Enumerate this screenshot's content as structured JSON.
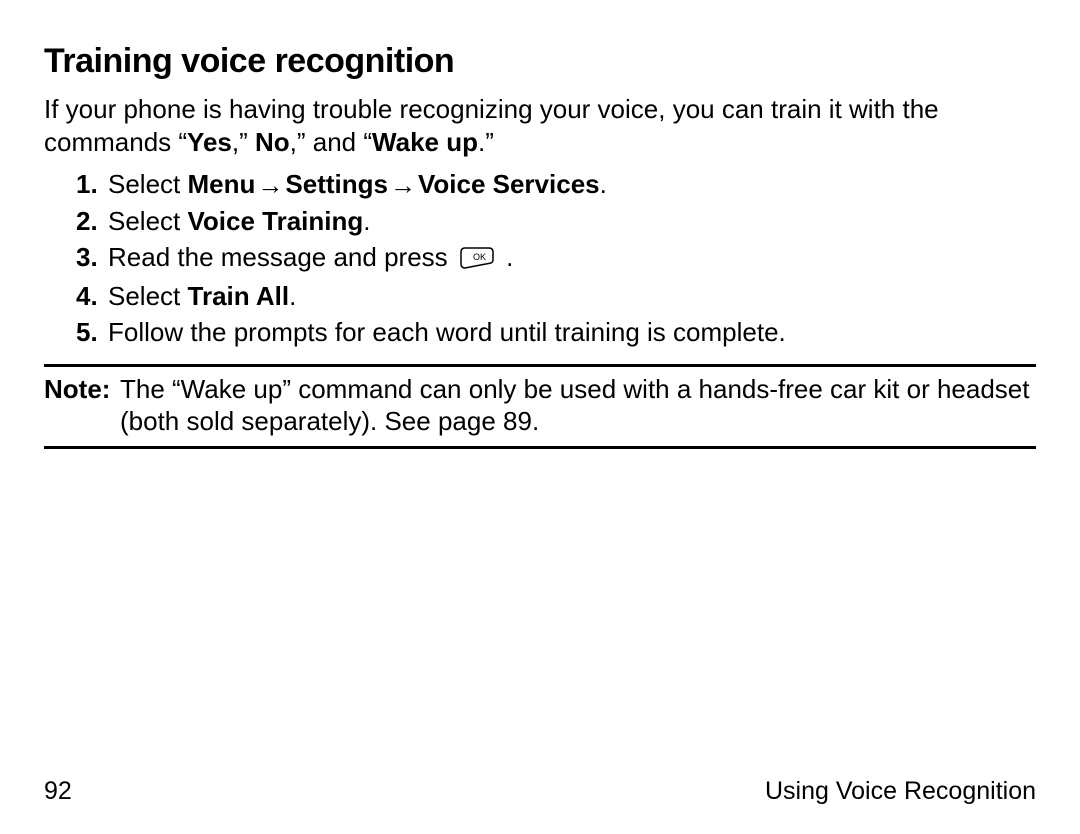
{
  "heading": "Training voice recognition",
  "intro": {
    "p1": "If your phone is having trouble recognizing your voice, you can train it with the commands “",
    "yes": "Yes",
    "p2": ",” ",
    "no": "No",
    "p3": ",” and “",
    "wake": "Wake up",
    "p4": ".”"
  },
  "steps": {
    "s1": {
      "num": "1.",
      "pre": "Select ",
      "menu": "Menu",
      "arr": " → ",
      "settings": "Settings",
      "vs": "Voice Services",
      "post": "."
    },
    "s2": {
      "num": "2.",
      "pre": "Select ",
      "vt": "Voice Training",
      "post": "."
    },
    "s3": {
      "num": "3.",
      "pre": "Read the message and press ",
      "post": " ."
    },
    "s4": {
      "num": "4.",
      "pre": "Select ",
      "ta": "Train All",
      "post": "."
    },
    "s5": {
      "num": "5.",
      "text": "Follow the prompts for each word until training is complete."
    }
  },
  "note": {
    "label": "Note:",
    "text": "The “Wake up” command can only be used with a hands-free car kit or headset (both sold separately). See page 89."
  },
  "footer": {
    "page": "92",
    "section": "Using Voice Recognition"
  }
}
